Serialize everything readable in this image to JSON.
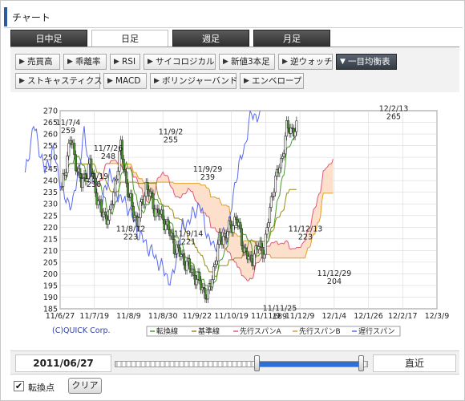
{
  "header": {
    "title": "チャート"
  },
  "tabs": [
    {
      "label": "日中足",
      "active": false
    },
    {
      "label": "日足",
      "active": true
    },
    {
      "label": "週足",
      "active": false
    },
    {
      "label": "月足",
      "active": false
    }
  ],
  "indicators": [
    {
      "label": "売買高",
      "active": false
    },
    {
      "label": "乖離率",
      "active": false
    },
    {
      "label": "RSI",
      "active": false
    },
    {
      "label": "サイコロジカル",
      "active": false
    },
    {
      "label": "新値3本足",
      "active": false
    },
    {
      "label": "逆ウォッチ",
      "active": false
    },
    {
      "label": "一目均衡表",
      "active": true
    },
    {
      "label": "ストキャスティクス",
      "active": false
    },
    {
      "label": "MACD",
      "active": false
    },
    {
      "label": "ボリンジャーバンド",
      "active": false
    },
    {
      "label": "エンベロープ",
      "active": false
    }
  ],
  "icons": {
    "dropdown_arrow": "triangle-right-icon",
    "checkbox": "check-icon"
  },
  "colors": {
    "accent": "#2d5aa0",
    "up": "#4a9a2a",
    "down": "#c8283c",
    "tenkan": "#4d5ee0",
    "kijun": "#9a8a1a",
    "span_a": "#e05a7a",
    "span_b": "#e0a020",
    "chikou": "#5a6af0",
    "cloud": "#fde0cc"
  },
  "chart_data": {
    "type": "candlestick",
    "title": "",
    "xlabel": "",
    "ylabel": "",
    "ylim": [
      185,
      270
    ],
    "y_ticks": [
      185,
      190,
      195,
      200,
      205,
      210,
      215,
      220,
      225,
      230,
      235,
      240,
      245,
      250,
      255,
      260,
      265,
      270
    ],
    "x_ticks": [
      "11/6/27",
      "11/7/19",
      "11/8/9",
      "11/8/30",
      "11/9/22",
      "11/10/19",
      "11/11/9",
      "11/12/9",
      "12/1/4",
      "12/1/26",
      "12/2/17",
      "12/3/9"
    ],
    "grid": true,
    "legend": {
      "position": "bottom",
      "entries": [
        "転換線",
        "基準線",
        "先行スパンA",
        "先行スパンB",
        "遅行スパン"
      ]
    },
    "annotations": [
      {
        "date": "11/7/4",
        "value": 259
      },
      {
        "date": "11/7/19",
        "value": 236
      },
      {
        "date": "11/7/26",
        "value": 248
      },
      {
        "date": "11/8/12",
        "value": 223
      },
      {
        "date": "11/9/2",
        "value": 255
      },
      {
        "date": "11/9/14",
        "value": 221
      },
      {
        "date": "11/9/29",
        "value": 239
      },
      {
        "date": "11/11/25",
        "value": 189
      },
      {
        "date": "11/12/13",
        "value": 223
      },
      {
        "date": "11/12/29",
        "value": 204
      },
      {
        "date": "12/2/13",
        "value": 265
      }
    ],
    "credit": "(C)QUICK Corp."
  },
  "controls": {
    "start_date": "2011/06/27",
    "latest_label": "直近",
    "range_start": 0.56,
    "range_end": 0.98,
    "show_turning_points": true,
    "turning_points_label": "転換点",
    "clear_label": "クリア"
  }
}
